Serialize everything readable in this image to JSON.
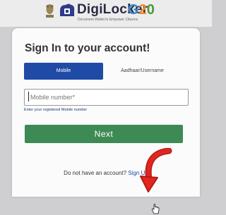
{
  "header": {
    "brand": "DigiLocker",
    "tagline": "Document Wallet to Empower Citizens",
    "g20": {
      "g": "G",
      "two": "2",
      "zero": "0"
    },
    "icons": [
      "national-emblem-icon",
      "digilocker-logo-icon"
    ]
  },
  "signin": {
    "title": "Sign In to your account!",
    "tabs": {
      "mobile": "Mobile",
      "aadhaar": "Aadhaar/Username"
    },
    "mobile_placeholder": "Mobile number*",
    "mobile_value": "",
    "hint": "Enter your registered Mobile number",
    "next_label": "Next",
    "signup_prompt": "Do not have an account?",
    "signup_link": "Sign Up"
  },
  "colors": {
    "tab_active": "#1f4ba7",
    "next_button": "#3e8a55",
    "annotation_arrow": "#e2261f"
  }
}
